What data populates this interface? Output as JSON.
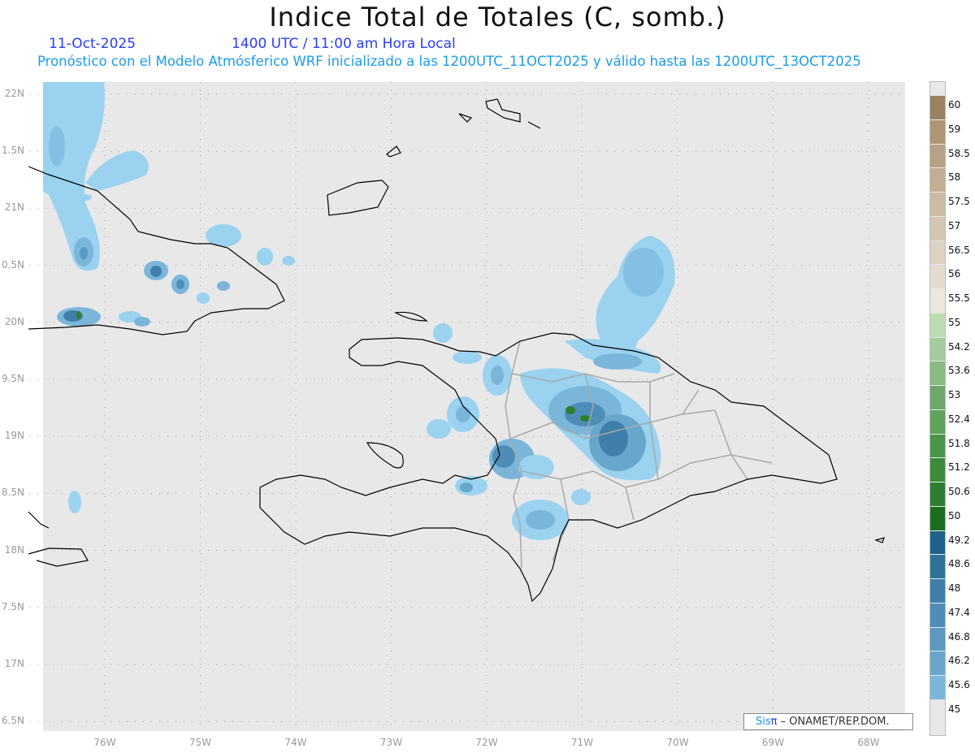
{
  "header": {
    "title": "Indice Total de Totales (C, somb.)",
    "date": "11-Oct-2025",
    "time": "1400 UTC / 11:00 am Hora Local",
    "subtitle": "Pronóstico con el Modelo Atmósferico WRF inicializado a las 1200UTC_11OCT2025 y válido hasta las  1200UTC_13OCT2025"
  },
  "axes": {
    "lat_labels": [
      "22N",
      "1.5N",
      "21N",
      "0.5N",
      "20N",
      "9.5N",
      "19N",
      "8.5N",
      "18N",
      "7.5N",
      "17N",
      "6.5N"
    ],
    "lon_labels": [
      "76W",
      "75W",
      "74W",
      "73W",
      "72W",
      "71W",
      "70W",
      "69W",
      "68W"
    ]
  },
  "colorbar": {
    "labels": [
      "60",
      "59",
      "58.5",
      "58",
      "57.5",
      "57",
      "56.5",
      "56",
      "55.5",
      "55",
      "54.2",
      "53.6",
      "53",
      "52.4",
      "51.8",
      "51.2",
      "50.6",
      "50",
      "49.2",
      "48.6",
      "48",
      "47.4",
      "46.8",
      "46.2",
      "45.6",
      "45"
    ],
    "colors": [
      "#9a8260",
      "#ae9574",
      "#b8a285",
      "#c2ae93",
      "#cbbba4",
      "#d3c6b2",
      "#dcd1c2",
      "#e3dbd0",
      "#ebe6de",
      "#bcdcb0",
      "#a2cc9b",
      "#88ba82",
      "#6ea96b",
      "#5ea35a",
      "#4a9648",
      "#3c8c3c",
      "#2e7d32",
      "#1a6e1e",
      "#1e638b",
      "#2e7299",
      "#3f7fa9",
      "#4e8db8",
      "#5b99c2",
      "#68a6cc",
      "#7bb6da",
      "#9ad2f0"
    ]
  },
  "credit": {
    "brand": "Sis",
    "brand_symbol": "π",
    "org": " –  ONAMET/REP.DOM."
  },
  "colors": {
    "land_outline": "#000000",
    "borders": "#a8a8a8",
    "background": "#e8e8e8"
  }
}
